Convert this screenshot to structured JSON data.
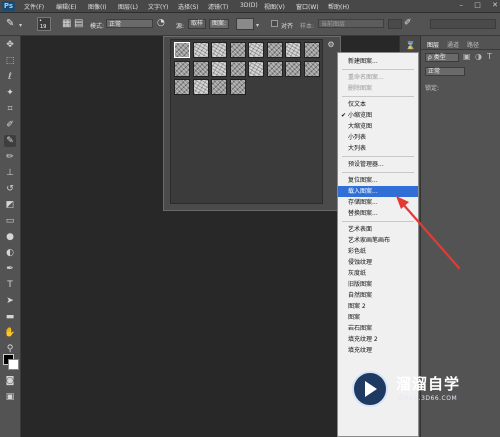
{
  "app": {
    "logo": "Ps"
  },
  "menubar": {
    "items": [
      "文件(F)",
      "编辑(E)",
      "图像(I)",
      "图层(L)",
      "文字(Y)",
      "选择(S)",
      "滤镜(T)",
      "3D(D)",
      "视图(V)",
      "窗口(W)",
      "帮助(H)"
    ],
    "window_controls": [
      "–",
      "□",
      "✕"
    ]
  },
  "options_bar": {
    "brush_size": "19",
    "mode_label": "模式:",
    "mode_value": "正常",
    "source_label": "源:",
    "source_sampled": "取样",
    "source_pattern": "图案:",
    "aligned_label": "对齐",
    "sample_label": "样本:",
    "sample_value": "当前图层"
  },
  "pattern_picker": {
    "swatch_rows": [
      [
        "dark",
        "light",
        "light",
        "dark",
        "light",
        "dark",
        "light",
        "dark"
      ],
      [
        "dark",
        "dark",
        "light",
        "dark",
        "light",
        "dark",
        "dark",
        "dark"
      ],
      [
        "dark",
        "light",
        "dark",
        "dark"
      ]
    ]
  },
  "dropdown": {
    "groups": [
      [
        {
          "label": "新建图案...",
          "enabled": true
        }
      ],
      [
        {
          "label": "重命名图案...",
          "enabled": false
        },
        {
          "label": "删除图案",
          "enabled": false
        }
      ],
      [
        {
          "label": "仅文本",
          "enabled": true
        },
        {
          "label": "小缩览图",
          "enabled": true,
          "checked": true
        },
        {
          "label": "大缩览图",
          "enabled": true
        },
        {
          "label": "小列表",
          "enabled": true
        },
        {
          "label": "大列表",
          "enabled": true
        }
      ],
      [
        {
          "label": "预设管理器...",
          "enabled": true
        }
      ],
      [
        {
          "label": "复位图案...",
          "enabled": true
        },
        {
          "label": "载入图案...",
          "enabled": true,
          "highlighted": true
        },
        {
          "label": "存储图案...",
          "enabled": true
        },
        {
          "label": "替换图案...",
          "enabled": true
        }
      ],
      [
        {
          "label": "艺术表面",
          "enabled": true
        },
        {
          "label": "艺术家画笔画布",
          "enabled": true
        },
        {
          "label": "彩色纸",
          "enabled": true
        },
        {
          "label": "侵蚀纹理",
          "enabled": true
        },
        {
          "label": "灰度纸",
          "enabled": true
        },
        {
          "label": "旧版图案",
          "enabled": true
        },
        {
          "label": "自然图案",
          "enabled": true
        },
        {
          "label": "图案 2",
          "enabled": true
        },
        {
          "label": "图案",
          "enabled": true
        },
        {
          "label": "岩石图案",
          "enabled": true
        },
        {
          "label": "填充纹理 2",
          "enabled": true
        },
        {
          "label": "填充纹理",
          "enabled": true
        }
      ]
    ]
  },
  "layers_panel": {
    "tabs": [
      "图层",
      "通道",
      "路径"
    ],
    "kind_label": "ρ 类型",
    "blend_mode": "正常",
    "lock_label": "锁定:"
  },
  "watermark": {
    "name": "溜溜自学",
    "url": "ZIXUE.3D66.COM"
  },
  "colors": {
    "highlight": "#2f6fd6",
    "arrow": "#e23b35",
    "watermark_bg": "#1f3a62"
  }
}
